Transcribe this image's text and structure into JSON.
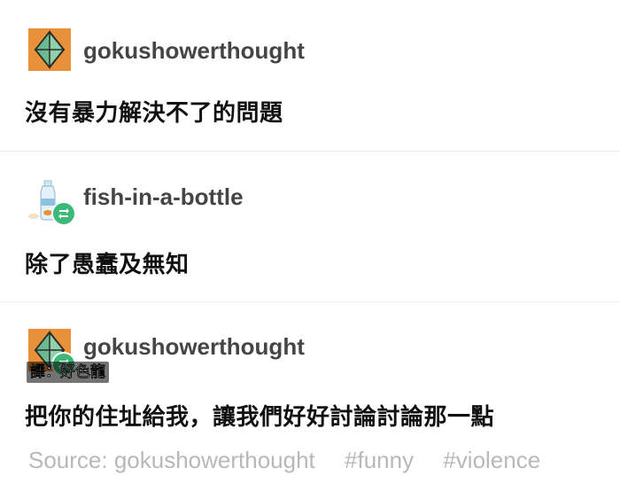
{
  "posts": [
    {
      "username": "gokushowerthought",
      "text": "沒有暴力解決不了的問題"
    },
    {
      "username": "fish-in-a-bottle",
      "text": "除了愚蠢及無知"
    },
    {
      "username": "gokushowerthought",
      "text": "把你的住址給我，讓我們好好討論討論那一點"
    }
  ],
  "watermark": "譯：好色龍",
  "footer": {
    "source": "Source: gokushowerthought",
    "tags": [
      "#funny",
      "#violence"
    ]
  },
  "colors": {
    "avatar_orange": "#e8913a",
    "avatar_green": "#7fc6a0",
    "reblog_green": "#3cb878",
    "username_gray": "#454545",
    "footer_gray": "#b8b8b8"
  }
}
